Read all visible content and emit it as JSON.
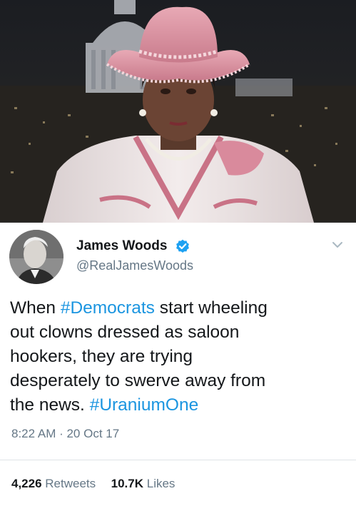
{
  "tweet": {
    "display_name": "James Woods",
    "handle": "@RealJamesWoods",
    "text_lines": [
      [
        {
          "t": "When ",
          "tag": false
        },
        {
          "t": "#Democrats",
          "tag": true
        },
        {
          "t": " start wheeling",
          "tag": false
        }
      ],
      [
        {
          "t": "out clowns dressed as saloon",
          "tag": false
        }
      ],
      [
        {
          "t": "hookers,  they are trying",
          "tag": false
        }
      ],
      [
        {
          "t": "desperately to swerve away from",
          "tag": false
        }
      ],
      [
        {
          "t": "the news. ",
          "tag": false
        },
        {
          "t": "#UraniumOne",
          "tag": true
        }
      ]
    ],
    "timestamp": "8:22 AM · 20 Oct 17",
    "retweets_count": "4,226",
    "retweets_label": "Retweets",
    "likes_count": "10.7K",
    "likes_label": "Likes"
  },
  "icons": {
    "verified": "verified-badge-icon",
    "more": "chevron-down-icon"
  },
  "colors": {
    "hashtag": "#1b95e0",
    "verified": "#1da1f2",
    "secondary_text": "#657786",
    "primary_text": "#14171a"
  }
}
